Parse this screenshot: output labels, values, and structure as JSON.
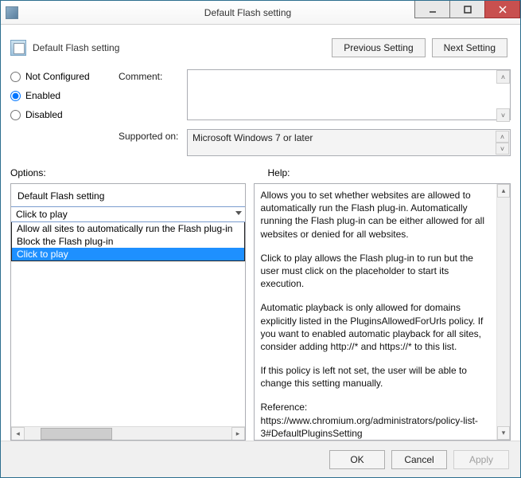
{
  "window": {
    "title": "Default Flash setting"
  },
  "header": {
    "title": "Default Flash setting",
    "prev": "Previous Setting",
    "next": "Next Setting"
  },
  "state": {
    "not_configured": "Not Configured",
    "enabled": "Enabled",
    "disabled": "Disabled",
    "selected": "enabled"
  },
  "labels": {
    "comment": "Comment:",
    "supported_on": "Supported on:",
    "options": "Options:",
    "help": "Help:"
  },
  "supported_on": "Microsoft Windows 7 or later",
  "options_panel": {
    "title": "Default Flash setting",
    "combo_value": "Click to play",
    "dropdown": [
      "Allow all sites to automatically run the Flash plug-in",
      "Block the Flash plug-in",
      "Click to play"
    ],
    "selected_index": 2
  },
  "help_paragraphs": [
    "Allows you to set whether websites are allowed to automatically run the Flash plug-in. Automatically running the Flash plug-in can be either allowed for all websites or denied for all websites.",
    "Click to play allows the Flash plug-in to run but the user must click on the placeholder to start its execution.",
    "Automatic playback is only allowed for domains explicitly listed in the PluginsAllowedForUrls policy. If you want to enabled automatic playback for all sites, consider adding http://* and https://* to this list.",
    "If this policy is left not set, the user will be able to change this setting manually.",
    "Reference: https://www.chromium.org/administrators/policy-list-3#DefaultPluginsSetting"
  ],
  "footer": {
    "ok": "OK",
    "cancel": "Cancel",
    "apply": "Apply"
  }
}
